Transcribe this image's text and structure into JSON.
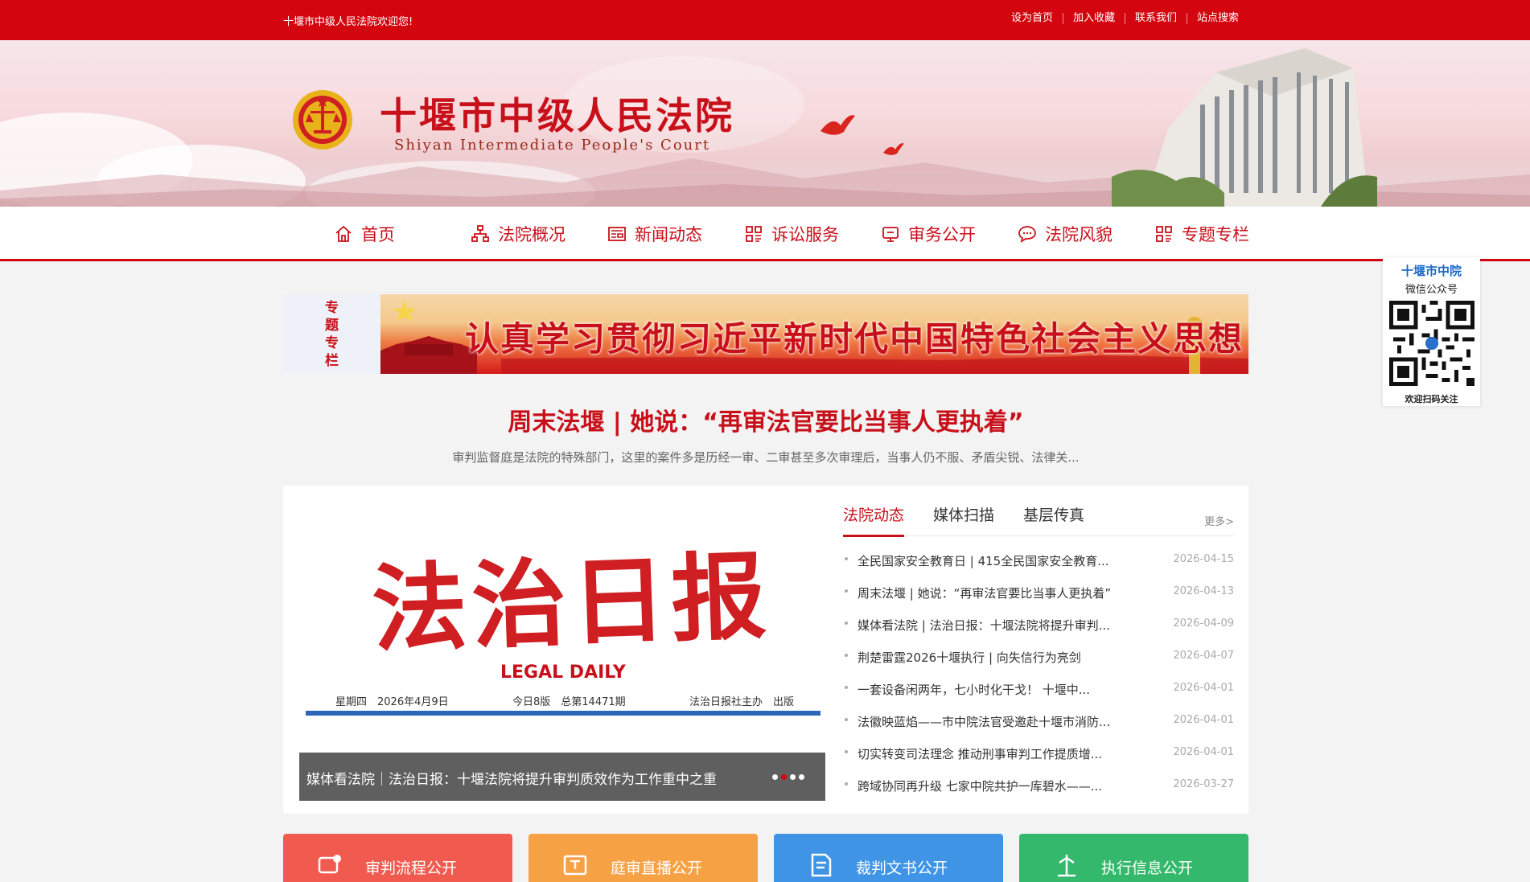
{
  "topbar": {
    "welcome": "十堰市中级人民法院欢迎您!",
    "links": [
      "设为首页",
      "加入收藏",
      "联系我们",
      "站点搜索"
    ]
  },
  "header": {
    "court_name": "十堰市中级人民法院",
    "court_name_en": "Shiyan Intermediate People's Court"
  },
  "nav": {
    "items": [
      {
        "label": "首页",
        "icon": "home-icon"
      },
      {
        "label": "法院概况",
        "icon": "org-chart-icon"
      },
      {
        "label": "新闻动态",
        "icon": "newspaper-icon"
      },
      {
        "label": "诉讼服务",
        "icon": "grid-icon"
      },
      {
        "label": "审务公开",
        "icon": "screen-icon"
      },
      {
        "label": "法院风貌",
        "icon": "chat-icon"
      },
      {
        "label": "专题专栏",
        "icon": "grid-icon"
      }
    ]
  },
  "wechat": {
    "title": "十堰市中院",
    "subtitle": "微信公众号",
    "hint": "欢迎扫码关注"
  },
  "special": {
    "label": "专题专栏",
    "slogan": "认真学习贯彻习近平新时代中国特色社会主义思想"
  },
  "feature": {
    "headline": "周末法堰 | 她说：“再审法官要比当事人更执着”",
    "summary": "审判监督庭是法院的特殊部门，这里的案件多是历经一审、二审甚至多次审理后，当事人仍不服、矛盾尖锐、法律关..."
  },
  "slider": {
    "paper_title": "法治日报",
    "paper_en": "LEGAL DAILY",
    "paper_day": "星期四　2026年4月9日",
    "paper_issue": "今日8版　总第14471期",
    "paper_publisher": "法治日报社主办　出版",
    "caption": "媒体看法院｜法治日报：十堰法院将提升审判质效作为工作重中之重",
    "slide_count": 4,
    "active_slide": 2
  },
  "news": {
    "tabs": [
      "法院动态",
      "媒体扫描",
      "基层传真"
    ],
    "active_tab": 0,
    "more": "更多>",
    "items": [
      {
        "title": "全民国家安全教育日 | 415全民国家安全教育...",
        "date": "2026-04-15"
      },
      {
        "title": "周末法堰 | 她说：“再审法官要比当事人更执着”",
        "date": "2026-04-13"
      },
      {
        "title": "媒体看法院 | 法治日报：十堰法院将提升审判...",
        "date": "2026-04-09"
      },
      {
        "title": "荆楚雷霆2026十堰执行 | 向失信行为亮剑",
        "date": "2026-04-07"
      },
      {
        "title": "一套设备闲两年，七小时化干戈！ 十堰中...",
        "date": "2026-04-01"
      },
      {
        "title": "法徽映蓝焰——市中院法官受邀赴十堰市消防...",
        "date": "2026-04-01"
      },
      {
        "title": "切实转变司法理念 推动刑事审判工作提质增...",
        "date": "2026-04-01"
      },
      {
        "title": "跨域协同再升级 七家中院共护一库碧水——...",
        "date": "2026-03-27"
      }
    ]
  },
  "quick_links": [
    {
      "label": "审判流程公开",
      "color": "#f05a4f",
      "icon": "process-icon"
    },
    {
      "label": "庭审直播公开",
      "color": "#f7a145",
      "icon": "live-icon"
    },
    {
      "label": "裁判文书公开",
      "color": "#3f94e6",
      "icon": "document-icon"
    },
    {
      "label": "执行信息公开",
      "color": "#34b86b",
      "icon": "execution-icon"
    }
  ]
}
